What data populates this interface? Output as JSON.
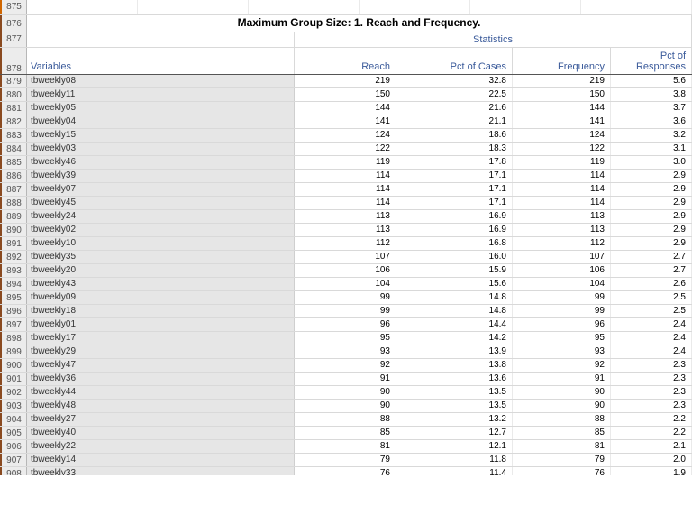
{
  "row_numbers_top": [
    "875",
    "876",
    "877",
    "878"
  ],
  "title": "Maximum Group Size: 1.  Reach and Frequency.",
  "header": {
    "variables": "Variables",
    "statistics": "Statistics",
    "cols": {
      "reach": "Reach",
      "pcases": "Pct of Cases",
      "freq": "Frequency",
      "presp": "Pct of Responses"
    }
  },
  "start_data_rownum": 879,
  "rows": [
    {
      "var": "tbweekly08",
      "reach": "219",
      "pcases": "32.8",
      "freq": "219",
      "presp": "5.6"
    },
    {
      "var": "tbweekly11",
      "reach": "150",
      "pcases": "22.5",
      "freq": "150",
      "presp": "3.8"
    },
    {
      "var": "tbweekly05",
      "reach": "144",
      "pcases": "21.6",
      "freq": "144",
      "presp": "3.7"
    },
    {
      "var": "tbweekly04",
      "reach": "141",
      "pcases": "21.1",
      "freq": "141",
      "presp": "3.6"
    },
    {
      "var": "tbweekly15",
      "reach": "124",
      "pcases": "18.6",
      "freq": "124",
      "presp": "3.2"
    },
    {
      "var": "tbweekly03",
      "reach": "122",
      "pcases": "18.3",
      "freq": "122",
      "presp": "3.1"
    },
    {
      "var": "tbweekly46",
      "reach": "119",
      "pcases": "17.8",
      "freq": "119",
      "presp": "3.0"
    },
    {
      "var": "tbweekly39",
      "reach": "114",
      "pcases": "17.1",
      "freq": "114",
      "presp": "2.9"
    },
    {
      "var": "tbweekly07",
      "reach": "114",
      "pcases": "17.1",
      "freq": "114",
      "presp": "2.9"
    },
    {
      "var": "tbweekly45",
      "reach": "114",
      "pcases": "17.1",
      "freq": "114",
      "presp": "2.9"
    },
    {
      "var": "tbweekly24",
      "reach": "113",
      "pcases": "16.9",
      "freq": "113",
      "presp": "2.9"
    },
    {
      "var": "tbweekly02",
      "reach": "113",
      "pcases": "16.9",
      "freq": "113",
      "presp": "2.9"
    },
    {
      "var": "tbweekly10",
      "reach": "112",
      "pcases": "16.8",
      "freq": "112",
      "presp": "2.9"
    },
    {
      "var": "tbweekly35",
      "reach": "107",
      "pcases": "16.0",
      "freq": "107",
      "presp": "2.7"
    },
    {
      "var": "tbweekly20",
      "reach": "106",
      "pcases": "15.9",
      "freq": "106",
      "presp": "2.7"
    },
    {
      "var": "tbweekly43",
      "reach": "104",
      "pcases": "15.6",
      "freq": "104",
      "presp": "2.6"
    },
    {
      "var": "tbweekly09",
      "reach": "99",
      "pcases": "14.8",
      "freq": "99",
      "presp": "2.5"
    },
    {
      "var": "tbweekly18",
      "reach": "99",
      "pcases": "14.8",
      "freq": "99",
      "presp": "2.5"
    },
    {
      "var": "tbweekly01",
      "reach": "96",
      "pcases": "14.4",
      "freq": "96",
      "presp": "2.4"
    },
    {
      "var": "tbweekly17",
      "reach": "95",
      "pcases": "14.2",
      "freq": "95",
      "presp": "2.4"
    },
    {
      "var": "tbweekly29",
      "reach": "93",
      "pcases": "13.9",
      "freq": "93",
      "presp": "2.4"
    },
    {
      "var": "tbweekly47",
      "reach": "92",
      "pcases": "13.8",
      "freq": "92",
      "presp": "2.3"
    },
    {
      "var": "tbweekly36",
      "reach": "91",
      "pcases": "13.6",
      "freq": "91",
      "presp": "2.3"
    },
    {
      "var": "tbweekly44",
      "reach": "90",
      "pcases": "13.5",
      "freq": "90",
      "presp": "2.3"
    },
    {
      "var": "tbweekly48",
      "reach": "90",
      "pcases": "13.5",
      "freq": "90",
      "presp": "2.3"
    },
    {
      "var": "tbweekly27",
      "reach": "88",
      "pcases": "13.2",
      "freq": "88",
      "presp": "2.2"
    },
    {
      "var": "tbweekly40",
      "reach": "85",
      "pcases": "12.7",
      "freq": "85",
      "presp": "2.2"
    },
    {
      "var": "tbweekly22",
      "reach": "81",
      "pcases": "12.1",
      "freq": "81",
      "presp": "2.1"
    },
    {
      "var": "tbweekly14",
      "reach": "79",
      "pcases": "11.8",
      "freq": "79",
      "presp": "2.0"
    },
    {
      "var": "tbweekly33",
      "reach": "76",
      "pcases": "11.4",
      "freq": "76",
      "presp": "1.9"
    }
  ]
}
